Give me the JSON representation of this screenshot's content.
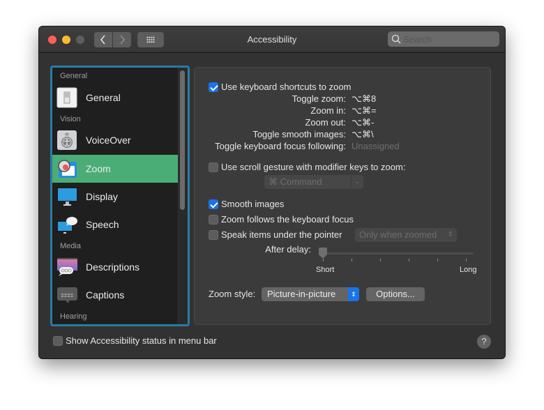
{
  "window": {
    "title": "Accessibility",
    "search_placeholder": "Search",
    "icons": {
      "back": "chevron-left-icon",
      "forward": "chevron-right-icon",
      "show_all": "grid-icon",
      "search": "magnifier-icon"
    }
  },
  "sidebar": {
    "sections": {
      "general": "General",
      "vision": "Vision",
      "media": "Media",
      "hearing": "Hearing"
    },
    "items": [
      {
        "label": "General",
        "icon": "switch-icon",
        "selected": false
      },
      {
        "label": "VoiceOver",
        "icon": "voiceover-icon",
        "selected": false
      },
      {
        "label": "Zoom",
        "icon": "zoom-magnifier-icon",
        "selected": true
      },
      {
        "label": "Display",
        "icon": "monitor-icon",
        "selected": false
      },
      {
        "label": "Speech",
        "icon": "speech-bubble-monitor-icon",
        "selected": false
      },
      {
        "label": "Descriptions",
        "icon": "descriptions-icon",
        "selected": false
      },
      {
        "label": "Captions",
        "icon": "captions-icon",
        "selected": false
      }
    ],
    "selected_color": "#4aad76"
  },
  "zoom_pane": {
    "keyboard_shortcuts": {
      "label": "Use keyboard shortcuts to zoom",
      "checked": true
    },
    "shortcuts": [
      {
        "label": "Toggle zoom:",
        "value": "⌥⌘8"
      },
      {
        "label": "Zoom in:",
        "value": "⌥⌘="
      },
      {
        "label": "Zoom out:",
        "value": "⌥⌘-"
      },
      {
        "label": "Toggle smooth images:",
        "value": "⌥⌘\\"
      },
      {
        "label": "Toggle keyboard focus following:",
        "value": "Unassigned"
      }
    ],
    "scroll_gesture": {
      "label": "Use scroll gesture with modifier keys to zoom:",
      "checked": false
    },
    "modifier_key": {
      "selected": "⌘ Command"
    },
    "smooth_images": {
      "label": "Smooth images",
      "checked": true
    },
    "follow_focus": {
      "label": "Zoom follows the keyboard focus",
      "checked": false
    },
    "speak_items": {
      "label": "Speak items under the pointer",
      "checked": false
    },
    "speak_when": {
      "selected": "Only when zoomed"
    },
    "after_delay": {
      "label": "After delay:",
      "min_label": "Short",
      "max_label": "Long",
      "value_fraction": 0.0
    },
    "zoom_style": {
      "label": "Zoom style:",
      "selected": "Picture-in-picture"
    },
    "options_button": "Options..."
  },
  "footer": {
    "menu_bar_status": {
      "label": "Show Accessibility status in menu bar",
      "checked": false
    },
    "help": "?"
  },
  "colors": {
    "accent": "#1a73e8",
    "sidebar_focus_ring": "#2a7ba4"
  }
}
